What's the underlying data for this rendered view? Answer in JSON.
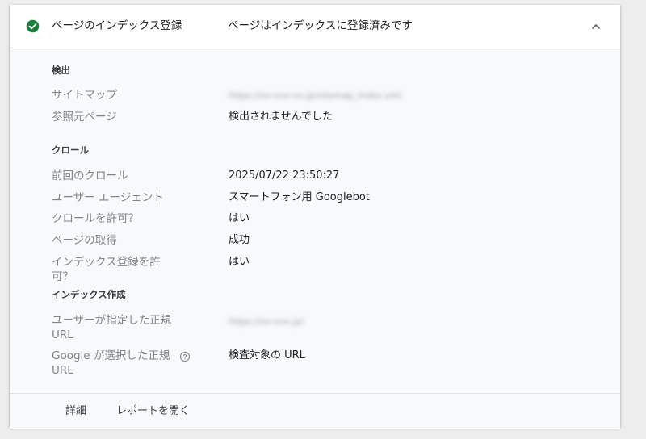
{
  "header": {
    "status_icon": "check-circle-icon",
    "status_color": "#188038",
    "title": "ページのインデックス登録",
    "status": "ページはインデックスに登録済みです",
    "collapse_icon": "chevron-up-icon"
  },
  "sections": {
    "discovery": {
      "title": "検出",
      "sitemap_label": "サイトマップ",
      "sitemap_value": "https://xx-xxx-xx.jp/sitemap_index.xml",
      "referring_label": "参照元ページ",
      "referring_value": "検出されませんでした"
    },
    "crawl": {
      "title": "クロール",
      "last_crawl_label": "前回のクロール",
      "last_crawl_value": "2025/07/22 23:50:27",
      "user_agent_label": "ユーザー エージェント",
      "user_agent_value": "スマートフォン用 Googlebot",
      "crawl_allowed_label": "クロールを許可？",
      "crawl_allowed_value": "はい",
      "page_fetch_label": "ページの取得",
      "page_fetch_value": "成功",
      "indexing_allowed_label": "インデックス登録を許可？",
      "indexing_allowed_value": "はい"
    },
    "indexing": {
      "title": "インデックス作成",
      "user_canonical_label": "ユーザーが指定した正規 URL",
      "user_canonical_value": "https://xx-xxx.jp/",
      "google_canonical_label": "Google が選択した正規 URL",
      "google_canonical_help_icon": "help-circle-icon",
      "google_canonical_value": "検査対象の URL"
    }
  },
  "footer": {
    "details": "詳細",
    "open_report": "レポートを開く"
  }
}
